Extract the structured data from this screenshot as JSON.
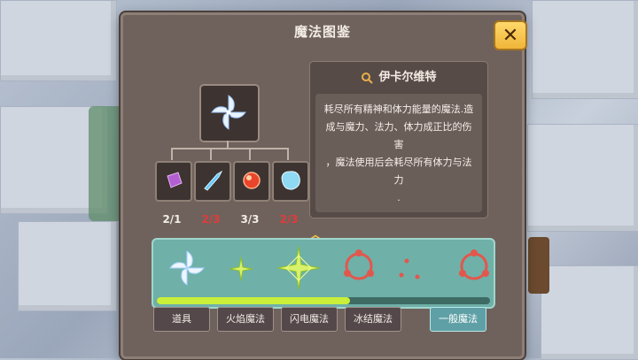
{
  "window": {
    "title": "魔法图鉴",
    "close_label": "✕"
  },
  "recipe": {
    "result_icon": "pinwheel-magic-icon",
    "materials": [
      {
        "icon": "purple-crystal-icon",
        "color": "#b25fd2",
        "count": "2/1",
        "status": "ok"
      },
      {
        "icon": "ice-shard-icon",
        "color": "#5fc8ff",
        "count": "2/3",
        "status": "insufficient"
      },
      {
        "icon": "red-gem-icon",
        "color": "#e8452b",
        "count": "3/3",
        "status": "ok"
      },
      {
        "icon": "ice-cube-icon",
        "color": "#8fd9f2",
        "count": "2/3",
        "status": "insufficient"
      }
    ]
  },
  "detail": {
    "name": "伊卡尔维特",
    "description_lines": [
      "耗尽所有精神和体力能量的魔法.造",
      "成与魔力、法力、体力成正比的伤害",
      "，魔法使用后会耗尽所有体力与法力",
      "."
    ]
  },
  "magic_list": {
    "items": [
      {
        "icon": "white-pinwheel-icon",
        "selected": true
      },
      {
        "icon": "small-green-star-icon"
      },
      {
        "icon": "large-green-star-icon"
      },
      {
        "icon": "red-ring-icon"
      },
      {
        "icon": "red-dots-icon"
      },
      {
        "icon": "red-ring-partial-icon"
      }
    ],
    "scroll_progress": 0.58
  },
  "tabs": [
    {
      "label": "道具",
      "active": false
    },
    {
      "label": "火焰魔法",
      "active": false
    },
    {
      "label": "闪电魔法",
      "active": false
    },
    {
      "label": "冰结魔法",
      "active": false
    },
    {
      "label": "一般魔法",
      "active": true
    }
  ],
  "colors": {
    "accent_gold": "#f0b53a",
    "insufficient_red": "#e23b3b",
    "scroll_green": "#c9ef3a",
    "active_tab": "#5fa0a6"
  }
}
